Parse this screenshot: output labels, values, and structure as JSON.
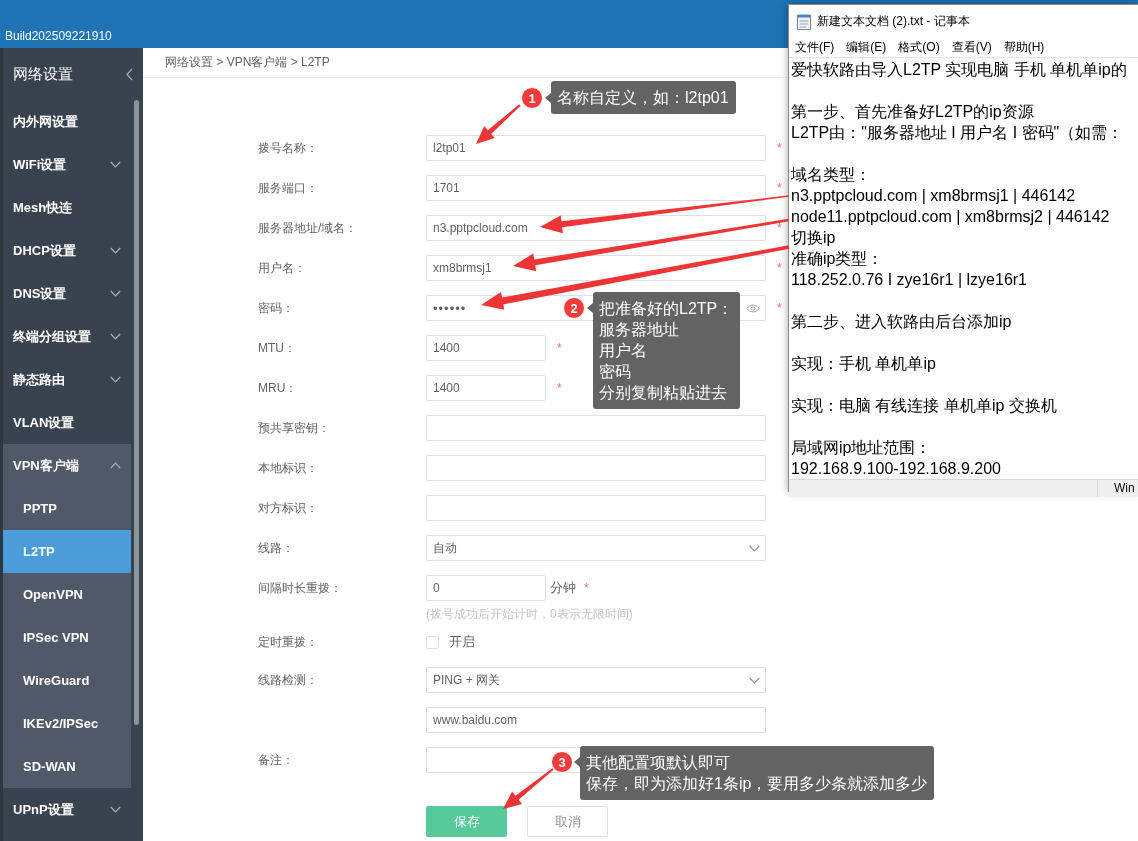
{
  "header": {
    "build": "Build202509221910"
  },
  "sidebar": {
    "title": "网络设置",
    "items": [
      {
        "label": "内外网设置",
        "kind": "link"
      },
      {
        "label": "WiFi设置",
        "kind": "group",
        "expanded": false
      },
      {
        "label": "Mesh快连",
        "kind": "link"
      },
      {
        "label": "DHCP设置",
        "kind": "group",
        "expanded": false
      },
      {
        "label": "DNS设置",
        "kind": "group",
        "expanded": false
      },
      {
        "label": "终端分组设置",
        "kind": "group",
        "expanded": false
      },
      {
        "label": "静态路由",
        "kind": "group",
        "expanded": false
      },
      {
        "label": "VLAN设置",
        "kind": "link"
      },
      {
        "label": "VPN客户端",
        "kind": "group",
        "expanded": true,
        "children": [
          {
            "label": "PPTP",
            "selected": false
          },
          {
            "label": "L2TP",
            "selected": true
          },
          {
            "label": "OpenVPN",
            "selected": false
          },
          {
            "label": "IPSec VPN",
            "selected": false
          },
          {
            "label": "WireGuard",
            "selected": false
          },
          {
            "label": "IKEv2/IPSec",
            "selected": false
          },
          {
            "label": "SD-WAN",
            "selected": false
          }
        ]
      },
      {
        "label": "UPnP设置",
        "kind": "group",
        "expanded": false
      }
    ]
  },
  "breadcrumb": "网络设置 > VPN客户端 > L2TP",
  "form": {
    "fields": [
      {
        "label": "拨号名称：",
        "kind": "text",
        "value": "l2tp01",
        "mark": "*"
      },
      {
        "label": "服务端口：",
        "kind": "text",
        "value": "1701",
        "mark": "*"
      },
      {
        "label": "服务器地址/域名：",
        "kind": "text",
        "value": "n3.pptpcloud.com",
        "mark": "*"
      },
      {
        "label": "用户名：",
        "kind": "text",
        "value": "xm8brmsj1",
        "mark": "*"
      },
      {
        "label": "密码：",
        "kind": "password",
        "value": "••••••",
        "mark": "*"
      },
      {
        "label": "MTU：",
        "kind": "short",
        "value": "1400",
        "mark": "*"
      },
      {
        "label": "MRU：",
        "kind": "short",
        "value": "1400",
        "mark": "*"
      },
      {
        "label": "预共享密钥：",
        "kind": "text"
      },
      {
        "label": "本地标识：",
        "kind": "text"
      },
      {
        "label": "对方标识：",
        "kind": "text"
      },
      {
        "label": "线路：",
        "kind": "select",
        "value": "自动"
      },
      {
        "label": "间隔时长重拨：",
        "kind": "short",
        "value": "0",
        "unit": "分钟",
        "mark": "*",
        "hint": "(拨号成功后开始计时，0表示无限时间)"
      },
      {
        "label": "定时重拨：",
        "kind": "checkbox",
        "option": "开启",
        "checked": false
      },
      {
        "label": "线路检测：",
        "kind": "select",
        "value": "PING + 网关"
      },
      {
        "kind": "text",
        "value": "www.baidu.com"
      },
      {
        "label": "备注：",
        "kind": "text"
      }
    ],
    "buttons": [
      {
        "label": "保存",
        "kind": "primary"
      },
      {
        "label": "取消",
        "kind": "secondary"
      }
    ]
  },
  "notepad": {
    "title": "新建文本文档 (2).txt - 记事本",
    "menu": [
      "文件(F)",
      "编辑(E)",
      "格式(O)",
      "查看(V)",
      "帮助(H)"
    ],
    "blocks": [
      [
        "爱快软路由导入L2TP 实现电脑 手机 单机单ip的"
      ],
      [
        "第一步、首先准备好L2TP的ip资源",
        "L2TP由：\"服务器地址 I 用户名 I 密码\"（如需："
      ],
      [
        "域名类型：",
        "n3.pptpcloud.com | xm8brmsj1 | 446142",
        "node11.pptpcloud.com | xm8brmsj2 | 446142",
        "切换ip",
        "准确ip类型：",
        "118.252.0.76 I zye16r1 | lzye16r1"
      ],
      [
        "第二步、进入软路由后台添加ip"
      ],
      [
        "实现：手机 单机单ip"
      ],
      [
        "实现：电脑 有线连接 单机单ip 交换机"
      ],
      [
        "局域网ip地址范围：",
        "192.168.9.100-192.168.9.200"
      ]
    ],
    "status": "Win"
  },
  "annotations": [
    {
      "number": "1",
      "lines": [
        "名称自定义，如：l2tp01"
      ]
    },
    {
      "number": "2",
      "lines": [
        "把准备好的L2TP：",
        "服务器地址",
        "用户名",
        "密码",
        "分别复制粘贴进去"
      ]
    },
    {
      "number": "3",
      "lines": [
        "其他配置项默认即可",
        "保存，即为添加好1条ip，要用多少条就添加多少"
      ]
    }
  ]
}
